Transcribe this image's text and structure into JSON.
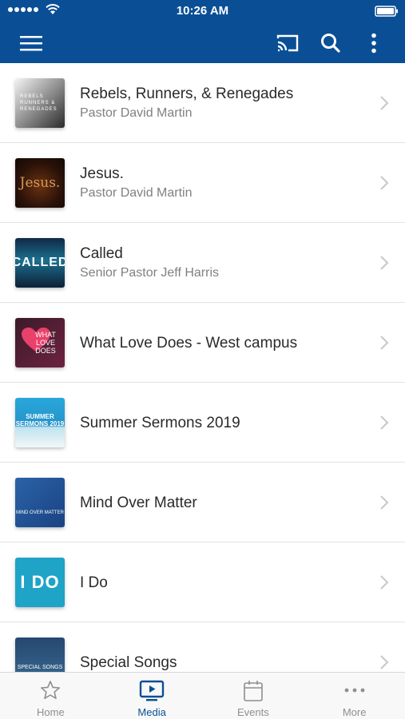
{
  "status_bar": {
    "time": "10:26 AM"
  },
  "media_items": [
    {
      "title": "Rebels, Runners, & Renegades",
      "subtitle": "Pastor David Martin",
      "thumb_text": "REBELS RUNNERS & RENEGADES"
    },
    {
      "title": "Jesus.",
      "subtitle": "Pastor David Martin",
      "thumb_text": "Jesus."
    },
    {
      "title": "Called",
      "subtitle": "Senior Pastor Jeff Harris",
      "thumb_text": "CALLED"
    },
    {
      "title": "What Love Does - West campus",
      "subtitle": "",
      "thumb_text": "WHAT LOVE DOES"
    },
    {
      "title": "Summer Sermons 2019",
      "subtitle": "",
      "thumb_text": "SUMMER SERMONS 2019"
    },
    {
      "title": "Mind Over Matter",
      "subtitle": "",
      "thumb_text": "MIND OVER MATTER"
    },
    {
      "title": "I Do",
      "subtitle": "",
      "thumb_text": "I DO"
    },
    {
      "title": "Special Songs",
      "subtitle": "",
      "thumb_text": "SPECIAL SONGS"
    }
  ],
  "tabs": [
    {
      "label": "Home",
      "icon": "star-icon",
      "active": false
    },
    {
      "label": "Media",
      "icon": "tv-play-icon",
      "active": true
    },
    {
      "label": "Events",
      "icon": "calendar-icon",
      "active": false
    },
    {
      "label": "More",
      "icon": "ellipsis-icon",
      "active": false
    }
  ],
  "colors": {
    "header": "#0a4f96",
    "active_tab": "#0a4f96",
    "inactive_tab": "#8e8e93"
  }
}
